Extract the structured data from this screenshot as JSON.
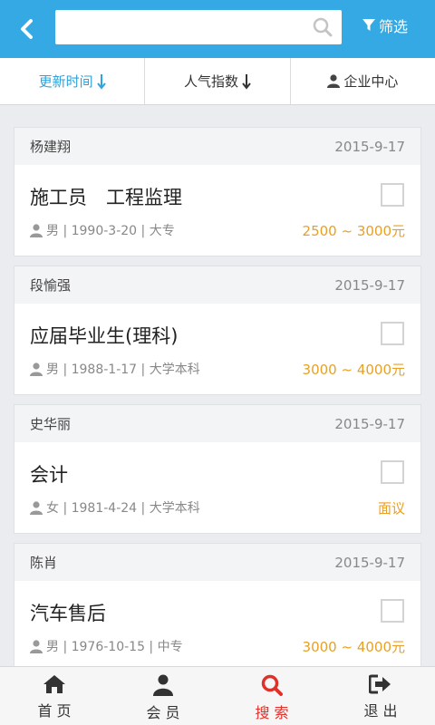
{
  "header": {
    "search_placeholder": "",
    "filter_label": "筛选"
  },
  "sortbar": {
    "items": [
      {
        "label": "更新时间",
        "active": true
      },
      {
        "label": "人气指数",
        "active": false
      },
      {
        "label": "企业中心",
        "active": false
      }
    ]
  },
  "resumes": [
    {
      "name": "杨建翔",
      "date": "2015-9-17",
      "title": "施工员　工程监理",
      "meta": "男 | 1990-3-20 | 大专",
      "salary": "2500 ~ 3000元"
    },
    {
      "name": "段愉强",
      "date": "2015-9-17",
      "title": "应届毕业生(理科)",
      "meta": "男 | 1988-1-17 | 大学本科",
      "salary": "3000 ~ 4000元"
    },
    {
      "name": "史华丽",
      "date": "2015-9-17",
      "title": "会计",
      "meta": "女 | 1981-4-24 | 大学本科",
      "salary": "面议"
    },
    {
      "name": "陈肖",
      "date": "2015-9-17",
      "title": "汽车售后",
      "meta": "男 | 1976-10-15 | 中专",
      "salary": "3000 ~ 4000元"
    }
  ],
  "bottomnav": {
    "items": [
      {
        "label": "首页",
        "icon": "home-icon",
        "active": false
      },
      {
        "label": "会员",
        "icon": "user-icon",
        "active": false
      },
      {
        "label": "搜索",
        "icon": "search-icon",
        "active": true
      },
      {
        "label": "退出",
        "icon": "logout-icon",
        "active": false
      }
    ]
  },
  "colors": {
    "header_bg": "#34a9e3",
    "active_sort": "#2fa3dc",
    "salary": "#e8a025",
    "active_nav": "#e0302a"
  }
}
